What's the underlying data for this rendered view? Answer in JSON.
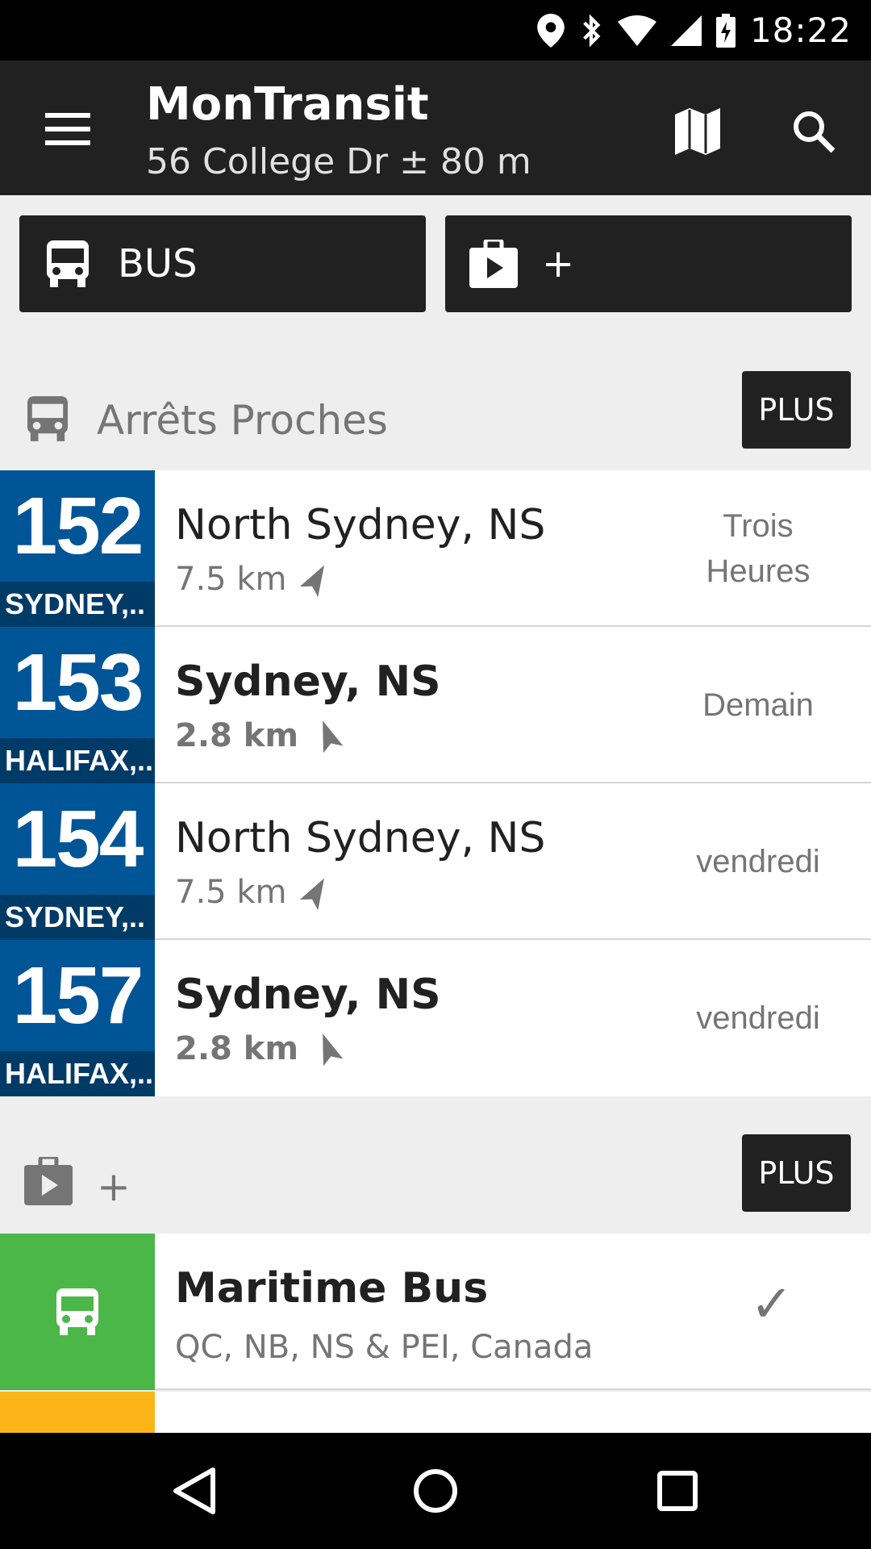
{
  "status_bar": {
    "time": "18:22"
  },
  "app_bar": {
    "title": "MonTransit",
    "subtitle": "56 College Dr ± 80 m"
  },
  "type_buttons": [
    {
      "label": "BUS",
      "icon": "bus-icon"
    },
    {
      "label": "+",
      "icon": "play-store-bag-icon"
    }
  ],
  "nearby": {
    "title": "Arrêts Proches",
    "more_label": "PLUS",
    "rows": [
      {
        "route": "152",
        "destination": "SYDNEY,..",
        "stop": "North Sydney, NS",
        "distance": "7.5 km",
        "time": "Trois Heures",
        "bold": false
      },
      {
        "route": "153",
        "destination": "HALIFAX,..",
        "stop": "Sydney, NS",
        "distance": "2.8 km",
        "time": "Demain",
        "bold": true
      },
      {
        "route": "154",
        "destination": "SYDNEY,..",
        "stop": "North Sydney, NS",
        "distance": "7.5 km",
        "time": "vendredi",
        "bold": false
      },
      {
        "route": "157",
        "destination": "HALIFAX,..",
        "stop": "Sydney, NS",
        "distance": "2.8 km",
        "time": "vendredi",
        "bold": true
      }
    ],
    "route_color": "#005596"
  },
  "agencies": {
    "title": "+",
    "more_label": "PLUS",
    "items": [
      {
        "name": "Maritime Bus",
        "region": "QC, NB, NS & PEI, Canada",
        "status": "✓",
        "color": "#4CB749"
      },
      {
        "name": "",
        "region": "",
        "status": "",
        "color": "#FBB519"
      }
    ]
  }
}
